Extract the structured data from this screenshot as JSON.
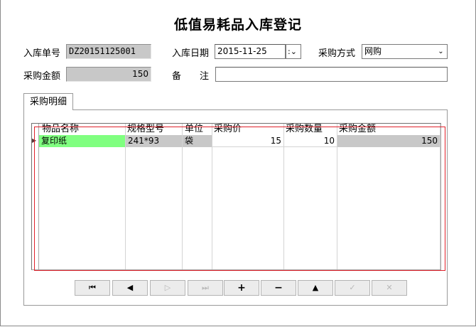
{
  "title": "低值易耗品入库登记",
  "form": {
    "order_no_label": "入库单号",
    "order_no": "DZ20151125001",
    "date_label": "入库日期",
    "date_value": "2015-11-25",
    "method_label": "采购方式",
    "method_value": "网购",
    "amount_label": "采购金额",
    "amount_value": "150",
    "remark_label": "备　　注",
    "remark_value": ""
  },
  "tab": {
    "label": "采购明细"
  },
  "grid": {
    "columns": [
      "物品名称",
      "规格型号",
      "单位",
      "采购价",
      "采购数量",
      "采购金额"
    ],
    "rows": [
      {
        "name": "复印纸",
        "spec": "241*93",
        "unit": "袋",
        "price": "15",
        "qty": "10",
        "amount": "150"
      }
    ],
    "row_indicator": "▶"
  },
  "navigator": {
    "first": "⏮",
    "prior": "◀",
    "next": "▷",
    "last": "⏭",
    "insert": "+",
    "delete": "−",
    "edit": "▲",
    "post": "✓",
    "cancel": "✕"
  },
  "colors": {
    "selected_cell": "#80ff80",
    "readonly_cell": "#c8c8c8",
    "grid_outline": "#e0202a"
  }
}
